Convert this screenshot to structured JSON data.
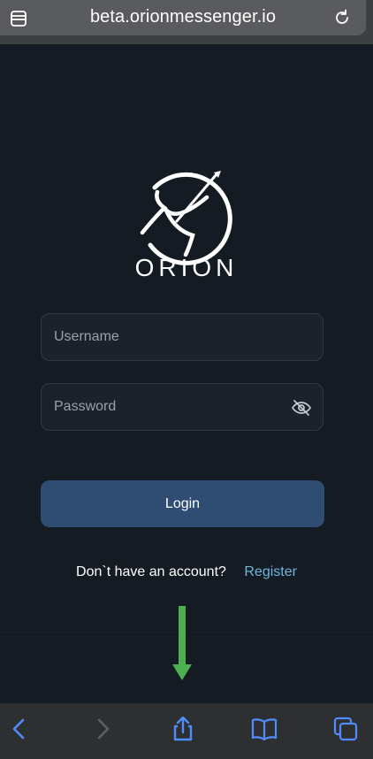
{
  "browser": {
    "url": "beta.orionmessenger.io",
    "icons": {
      "tabs": "tabs-icon",
      "reload": "reload-icon",
      "back": "back-icon",
      "forward": "forward-icon",
      "share": "share-icon",
      "bookmarks": "book-icon",
      "tabs_overview": "tabs-overview-icon"
    }
  },
  "logo": {
    "wordmark": "ORION"
  },
  "form": {
    "username_placeholder": "Username",
    "password_placeholder": "Password",
    "login_label": "Login",
    "register_prompt": "Don`t have an account?",
    "register_link": "Register"
  },
  "colors": {
    "background": "#151b22",
    "button": "#2f4d73",
    "link": "#6fb6df",
    "annotation_arrow": "#4caf50"
  }
}
